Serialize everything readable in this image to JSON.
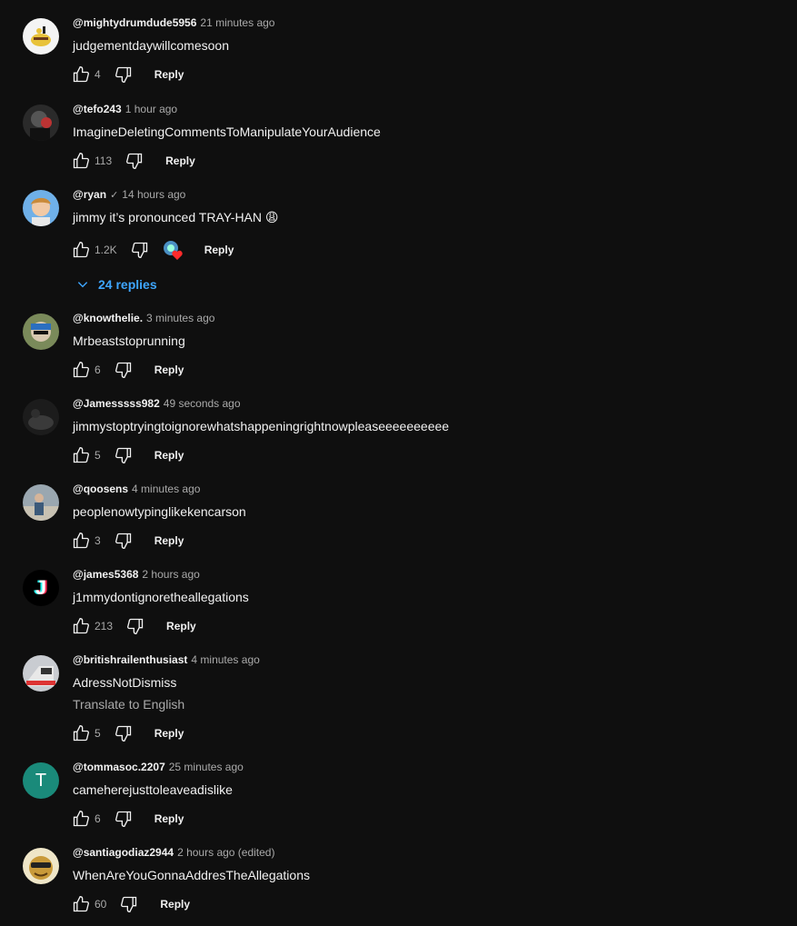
{
  "labels": {
    "reply": "Reply",
    "translate": "Translate to English",
    "verified": "✓"
  },
  "colors": {
    "background": "#0f0f0f",
    "text": "#f1f1f1",
    "secondary": "#aaaaaa",
    "link": "#3ea6ff"
  },
  "comments": [
    {
      "author": "@mightydrumdude5956",
      "time": "21 minutes ago",
      "text": "judgementdaywillcomesoon",
      "likes": "4"
    },
    {
      "author": "@tefo243",
      "time": "1 hour ago",
      "text": "ImagineDeletingCommentsToManipulateYourAudience",
      "likes": "113"
    },
    {
      "author": "@ryan",
      "time": "14 hours ago",
      "text": "jimmy it’s pronounced TRAY-HAN 😩",
      "likes": "1.2K",
      "replies": "24 replies"
    },
    {
      "author": "@knowthelie.",
      "time": "3 minutes ago",
      "text": "Mrbeaststoprunning",
      "likes": "6"
    },
    {
      "author": "@Jamesssss982",
      "time": "49 seconds ago",
      "text": "jimmystoptryingtoignorewhatshappeningrightnowpleaseeeeeeeeee",
      "likes": "5"
    },
    {
      "author": "@qoosens",
      "time": "4 minutes ago",
      "text": "peoplenowtypinglikekencarson",
      "likes": "3"
    },
    {
      "author": "@james5368",
      "time": "2 hours ago",
      "text": "j1mmydontignoretheallegations",
      "likes": "213",
      "avatar_letter": "J"
    },
    {
      "author": "@britishrailenthusiast",
      "time": "4 minutes ago",
      "text": "AdressNotDismiss",
      "likes": "5"
    },
    {
      "author": "@tommasoc.2207",
      "time": "25 minutes ago",
      "text": "cameherejusttoleaveadislike",
      "likes": "6",
      "avatar_letter": "T"
    },
    {
      "author": "@santiagodiaz2944",
      "time": "2 hours ago (edited)",
      "text": "WhenAreYouGonnaAddresTheAllegations",
      "likes": "60"
    }
  ]
}
